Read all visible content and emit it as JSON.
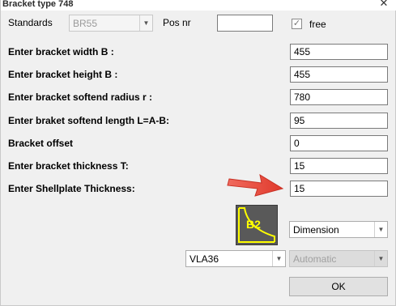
{
  "window": {
    "title": "Bracket type 748",
    "close_glyph": "✕"
  },
  "standards": {
    "label": "Standards",
    "value": "BR55",
    "arrow": "▼"
  },
  "pos_nr": {
    "label": "Pos nr",
    "value": ""
  },
  "free": {
    "label": "free",
    "checked": true,
    "check_glyph": "✓"
  },
  "fields": [
    {
      "label": "Enter bracket width B :",
      "value": "455"
    },
    {
      "label": "Enter bracket height B :",
      "value": "455"
    },
    {
      "label": "Enter bracket softend radius r :",
      "value": "780"
    },
    {
      "label": "Enter braket softend length L=A-B:",
      "value": "95"
    },
    {
      "label": "Bracket offset",
      "value": "0"
    },
    {
      "label": "Enter bracket thickness T:",
      "value": "15"
    },
    {
      "label": "Enter Shellplate Thickness:",
      "value": "15"
    }
  ],
  "bracket_icon": {
    "text": "B2",
    "icon": "bracket-b2-icon",
    "text_color": "#ffff00",
    "bg_color": "#595959"
  },
  "dimension": {
    "value": "Dimension",
    "arrow": "▼"
  },
  "material": {
    "value": "VLA36",
    "arrow": "▼"
  },
  "mode": {
    "value": "Automatic",
    "arrow": "▼"
  },
  "ok_button": {
    "label": "OK"
  },
  "annotation": {
    "icon": "red-arrow-icon",
    "color": "#e8433a"
  }
}
